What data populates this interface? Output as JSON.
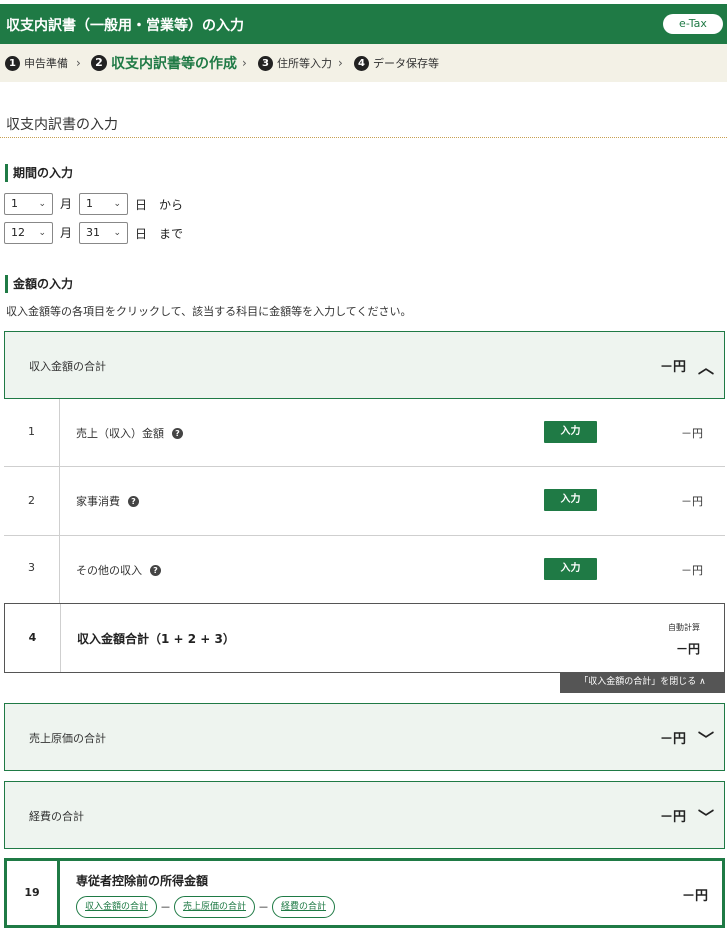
{
  "header": {
    "title": "収支内訳書（一般用・営業等）の入力",
    "etax": "e-Tax"
  },
  "steps": [
    {
      "num": "1",
      "label": "申告準備"
    },
    {
      "num": "2",
      "label": "収支内訳書等の作成"
    },
    {
      "num": "3",
      "label": "住所等入力"
    },
    {
      "num": "4",
      "label": "データ保存等"
    }
  ],
  "step_sep": "›",
  "page_title": "収支内訳書の入力",
  "period": {
    "heading": "期間の入力",
    "from_month": "1",
    "from_day": "1",
    "to_month": "12",
    "to_day": "31",
    "month_label": "月",
    "day_label": "日",
    "from_label": "から",
    "to_label": "まで"
  },
  "amount": {
    "heading": "金額の入力",
    "description": "収入金額等の各項目をクリックして、該当する科目に金額等を入力してください。"
  },
  "income_section": {
    "label": "収入金額の合計",
    "total": "－円",
    "rows": [
      {
        "num": "1",
        "name": "売上（収入）金額",
        "btn": "入力",
        "amount": "－円"
      },
      {
        "num": "2",
        "name": "家事消費",
        "btn": "入力",
        "amount": "－円"
      },
      {
        "num": "3",
        "name": "その他の収入",
        "btn": "入力",
        "amount": "－円"
      }
    ],
    "total_row": {
      "num": "4",
      "name": "収入金額合計（1 + 2 + 3）",
      "auto": "自動計算",
      "amount": "－円"
    },
    "close_label": "「収入金額の合計」を閉じる ∧"
  },
  "cogs_section": {
    "label": "売上原価の合計",
    "total": "－円"
  },
  "expense_section": {
    "label": "経費の合計",
    "total": "－円"
  },
  "final": {
    "num": "19",
    "name": "専従者控除前の所得金額",
    "chips": [
      "収入金額の合計",
      "売上原価の合計",
      "経費の合計"
    ],
    "minus": "－",
    "amount": "－円"
  },
  "icons": {
    "select": "chevron-down-icon",
    "expand": "chevron-up-icon",
    "collapse": "chevron-down-icon",
    "help": "question-icon"
  },
  "colors": {
    "brand": "#1f7a45",
    "steps_bg": "#f3f1e6",
    "panel_bg": "#eef4ef",
    "close_bg": "#555555"
  }
}
